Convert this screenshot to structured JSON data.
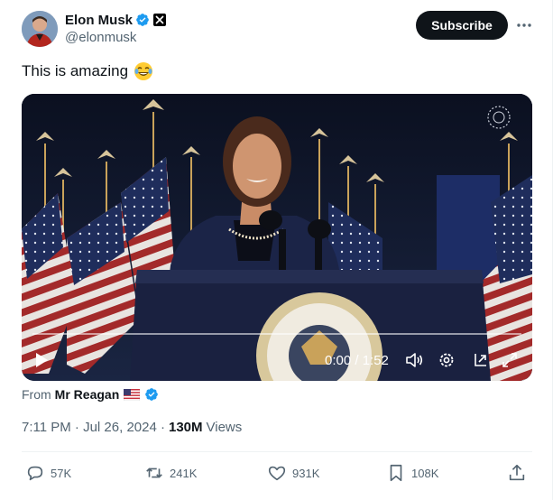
{
  "author": {
    "name": "Elon Musk",
    "handle": "@elonmusk"
  },
  "header": {
    "subscribe_label": "Subscribe",
    "more_icon": "more-icon"
  },
  "tweet": {
    "text": "This is amazing",
    "emoji": "😂"
  },
  "video": {
    "time": "0:00 / 1:52",
    "progress": 0,
    "controls": [
      "play-icon",
      "volume-icon",
      "settings-icon",
      "popout-icon",
      "fullscreen-icon"
    ],
    "watermark_icon": "seal-watermark-icon"
  },
  "attribution": {
    "prefix": "From",
    "source_name": "Mr Reagan"
  },
  "meta": {
    "datetime": "7:11 PM · Jul 26, 2024 ·",
    "views_count": "130M",
    "views_label": "Views"
  },
  "actions": {
    "replies": "57K",
    "reposts": "241K",
    "likes": "931K",
    "bookmarks": "108K"
  },
  "colors": {
    "verified": "#1d9bf0",
    "text_secondary": "#536471",
    "subscribe_bg": "#0f1419"
  }
}
